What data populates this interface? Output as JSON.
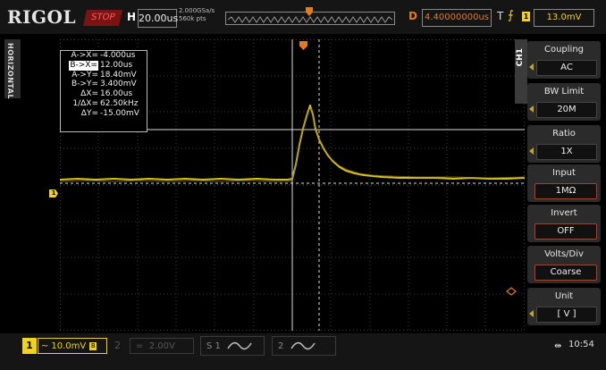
{
  "topbar": {
    "brand": "RIGOL",
    "run_state": "STOP",
    "horizontal_label": "H",
    "timebase": "20.00us",
    "sample_rate": "2.000GSa/s",
    "memory_depth": "560k pts",
    "delay_label": "D",
    "delay_value": "4.40000000us",
    "trigger_label": "T",
    "trigger_source": "1",
    "trigger_level": "13.0mV"
  },
  "left_tab": {
    "label": "HORIZONTAL"
  },
  "measurement": {
    "rows": [
      {
        "key": "A->X=",
        "value": "-4.000us",
        "highlight": false
      },
      {
        "key": "B->X=",
        "value": "12.00us",
        "highlight": true
      },
      {
        "key": "A->Y=",
        "value": "18.40mV",
        "highlight": false
      },
      {
        "key": "B->Y=",
        "value": "3.400mV",
        "highlight": false
      },
      {
        "key": "ΔX=",
        "value": "16.00us",
        "highlight": false
      },
      {
        "key": "1/ΔX=",
        "value": "62.50kHz",
        "highlight": false
      },
      {
        "key": "ΔY=",
        "value": "-15.00mV",
        "highlight": false
      }
    ]
  },
  "markers": {
    "ch1": "1"
  },
  "menu": {
    "channel_tab": "CH1",
    "items": [
      {
        "label": "Coupling",
        "value": "AC"
      },
      {
        "label": "BW Limit",
        "value": "20M"
      },
      {
        "label": "Ratio",
        "value": "1X"
      },
      {
        "label": "Input",
        "value": "1MΩ"
      },
      {
        "label": "Invert",
        "value": "OFF"
      },
      {
        "label": "Volts/Div",
        "value": "Coarse"
      },
      {
        "label": "Unit",
        "value": "[ V ]"
      }
    ]
  },
  "bottombar": {
    "ch1_number": "1",
    "ch1_scale": "10.0mV",
    "ch1_bw_badge": "B",
    "ch2_number": "2",
    "ch2_scale": "2.00V",
    "s1_label": "S 1",
    "s2_label": "2",
    "time": "10:54"
  },
  "colors": {
    "ch1": "#f2d21b",
    "trigger_delay": "#e07b1e",
    "stop": "#ff5a5a",
    "grid": "#3c3c3c"
  }
}
